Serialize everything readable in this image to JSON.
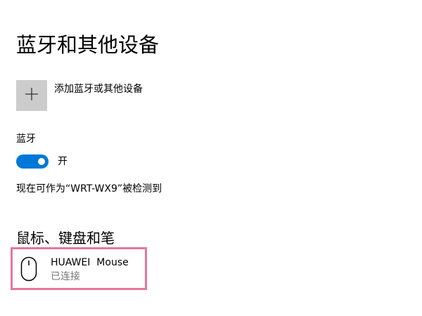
{
  "page": {
    "title": "蓝牙和其他设备"
  },
  "add_device": {
    "icon": "plus-icon",
    "label": "添加蓝牙或其他设备"
  },
  "bluetooth": {
    "label": "蓝牙",
    "toggle_state": "on",
    "toggle_text": "开",
    "accent_color": "#0078d7",
    "discoverable_text": "现在可作为“WRT-WX9”被检测到"
  },
  "mouse_section": {
    "title": "鼠标、键盘和笔",
    "highlight_color": "#e8769e",
    "devices": [
      {
        "icon": "mouse-icon",
        "name": "HUAWEI  Mouse",
        "status": "已连接"
      }
    ]
  }
}
